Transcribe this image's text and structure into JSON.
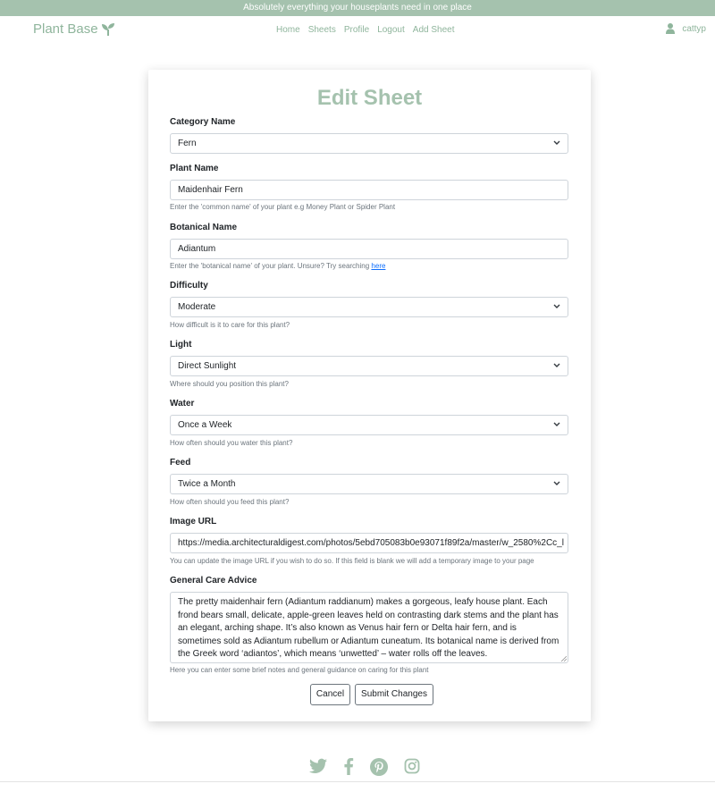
{
  "banner": {
    "text": "Absolutely everything your houseplants need in one place"
  },
  "nav": {
    "brand": "Plant Base",
    "links": [
      "Home",
      "Sheets",
      "Profile",
      "Logout",
      "Add Sheet"
    ],
    "username": "cattyp"
  },
  "form": {
    "title": "Edit Sheet",
    "category": {
      "label": "Category Name",
      "value": "Fern"
    },
    "plant_name": {
      "label": "Plant Name",
      "value": "Maidenhair Fern",
      "help": "Enter the 'common name' of your plant e.g Money Plant or Spider Plant"
    },
    "botanical_name": {
      "label": "Botanical Name",
      "value": "Adiantum",
      "help": "Enter the 'botanical name' of your plant. Unsure? Try searching",
      "help_link": "here"
    },
    "difficulty": {
      "label": "Difficulty",
      "value": "Moderate",
      "help": "How difficult is it to care for this plant?"
    },
    "light": {
      "label": "Light",
      "value": "Direct Sunlight",
      "help": "Where should you position this plant?"
    },
    "water": {
      "label": "Water",
      "value": "Once a Week",
      "help": "How often should you water this plant?"
    },
    "feed": {
      "label": "Feed",
      "value": "Twice a Month",
      "help": "How often should you feed this plant?"
    },
    "image_url": {
      "label": "Image URL",
      "value": "https://media.architecturaldigest.com/photos/5ebd705083b0e93071f89f2a/master/w_2580%2Cc_l",
      "help": "You can update the image URL if you wish to do so. If this field is blank we will add a temporary image to your page"
    },
    "care_advice": {
      "label": "General Care Advice",
      "value": "The pretty maidenhair fern (Adiantum raddianum) makes a gorgeous, leafy house plant. Each frond bears small, delicate, apple-green leaves held on contrasting dark stems and the plant has an elegant, arching shape. It’s also known as Venus hair fern or Delta hair fern, and is sometimes sold as Adiantum rubellum or Adiantum cuneatum. Its botanical name is derived from the Greek word ‘adiantos’, which means ‘unwetted’ – water rolls off the leaves.",
      "help": "Here you can enter some brief notes and general guidance on caring for this plant"
    },
    "cancel_label": "Cancel",
    "submit_label": "Submit Changes"
  },
  "footer": {
    "icons": [
      "twitter-icon",
      "facebook-icon",
      "pinterest-icon",
      "instagram-icon"
    ]
  },
  "colors": {
    "accent": "#a5c2ae",
    "brand_text": "#8fb59c"
  }
}
